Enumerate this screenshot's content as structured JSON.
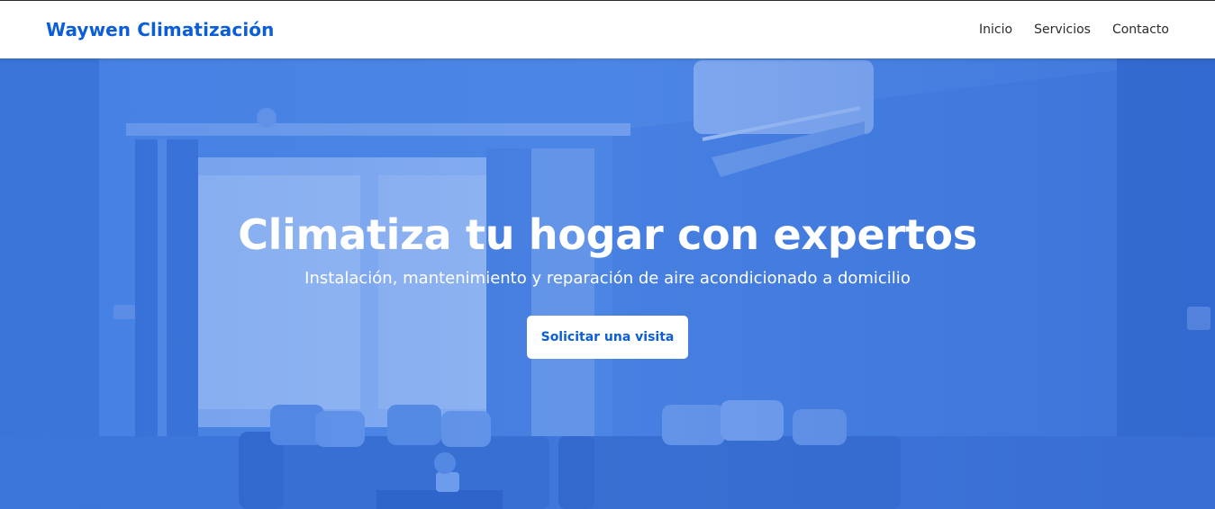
{
  "header": {
    "brand": "Waywen Climatización",
    "nav": [
      {
        "label": "Inicio"
      },
      {
        "label": "Servicios"
      },
      {
        "label": "Contacto"
      }
    ]
  },
  "hero": {
    "title": "Climatiza tu hogar con expertos",
    "subtitle": "Instalación, mantenimiento y reparación de aire acondicionado a domicilio",
    "cta_label": "Solicitar una visita"
  },
  "colors": {
    "brand": "#0b5ed7",
    "hero_tint": "#4d84e4",
    "text_light": "#ffffff",
    "nav_text": "#2b2b2b"
  }
}
